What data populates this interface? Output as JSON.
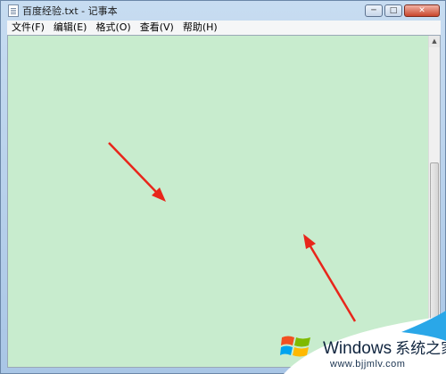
{
  "window": {
    "title": "百度经验.txt - 记事本",
    "controls": {
      "minimize_icon": "minimize-icon",
      "maximize_icon": "maximize-icon",
      "close_icon": "close-icon"
    }
  },
  "menubar": {
    "items": [
      {
        "label": "文件(F)"
      },
      {
        "label": "编辑(E)"
      },
      {
        "label": "格式(O)"
      },
      {
        "label": "查看(V)"
      },
      {
        "label": "帮助(H)"
      }
    ]
  },
  "editor": {
    "content": "",
    "background_color": "#c8ecce"
  },
  "annotations": {
    "arrow_color": "#e8261b"
  },
  "watermark": {
    "brand": "Windows",
    "suffix": "系统之家",
    "url": "www.bjjmlv.com"
  }
}
